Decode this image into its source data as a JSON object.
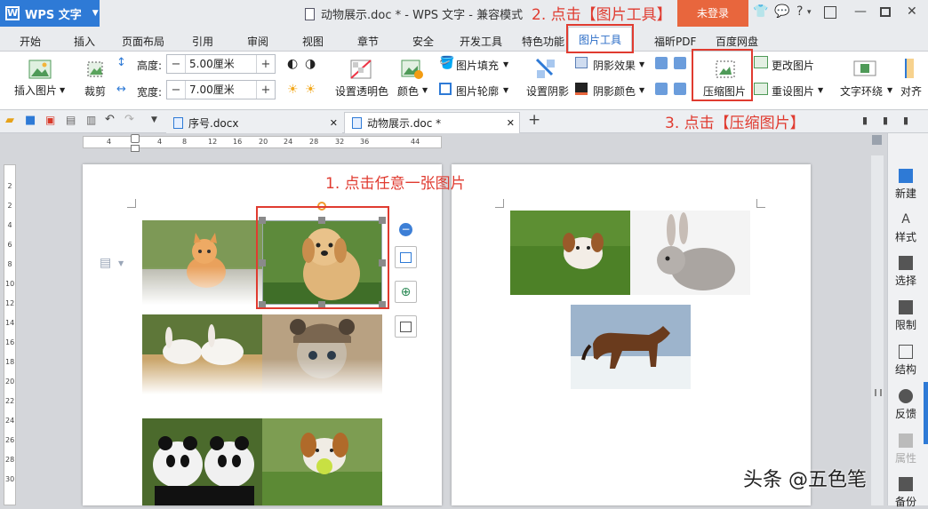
{
  "app": {
    "name": "WPS 文字",
    "document_title": "动物展示.doc * - WPS 文字 - 兼容模式",
    "login_label": "未登录"
  },
  "menu_tabs": [
    "开始",
    "插入",
    "页面布局",
    "引用",
    "审阅",
    "视图",
    "章节",
    "安全",
    "开发工具",
    "特色功能",
    "图片工具",
    "福昕PDF",
    "百度网盘"
  ],
  "active_tab": "图片工具",
  "ribbon": {
    "insert_picture": "插入图片",
    "crop": "裁剪",
    "height_label": "高度:",
    "height_value": "5.00厘米",
    "width_label": "宽度:",
    "width_value": "7.00厘米",
    "set_transparent": "设置透明色",
    "color": "颜色",
    "picture_fill": "图片填充",
    "picture_outline": "图片轮廓",
    "set_shadow": "设置阴影",
    "shadow_effect": "阴影效果",
    "shadow_color": "阴影颜色",
    "compress_picture": "压缩图片",
    "change_picture": "更改图片",
    "reset_picture": "重设图片",
    "text_wrap": "文字环绕",
    "align": "对齐"
  },
  "file_tabs": [
    "序号.docx",
    "动物展示.doc *"
  ],
  "ruler_ticks": [
    "4",
    "4",
    "8",
    "12",
    "16",
    "20",
    "24",
    "28",
    "32",
    "36",
    "44"
  ],
  "left_ruler_ticks": [
    "2",
    "2",
    "4",
    "6",
    "8",
    "10",
    "12",
    "14",
    "16",
    "18",
    "20",
    "22",
    "24",
    "26",
    "28",
    "30"
  ],
  "right_sidebar": [
    "新建",
    "样式",
    "选择",
    "限制",
    "结构",
    "反馈",
    "属性",
    "备份"
  ],
  "annotations": {
    "step1": "1. 点击任意一张图片",
    "step2": "2. 点击【图片工具】",
    "step3": "3. 点击【压缩图片】"
  },
  "watermark": "头条 @五色笔",
  "colors": {
    "accent": "#2e7ad6",
    "login": "#e8663d",
    "annotation": "#e03b30"
  }
}
